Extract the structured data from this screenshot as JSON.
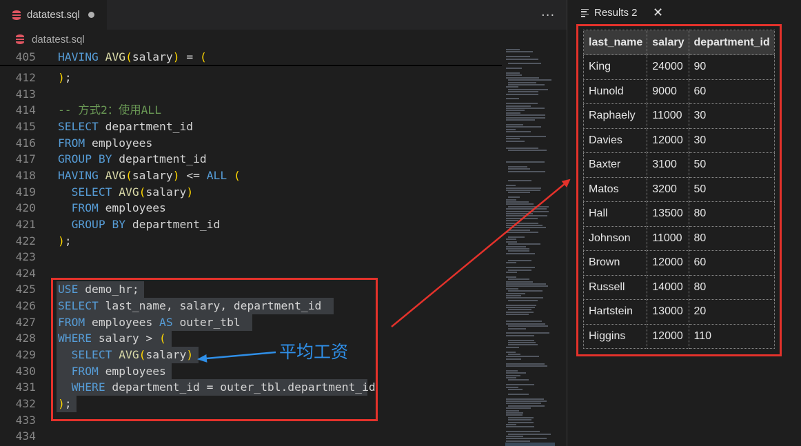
{
  "editor_tab": {
    "title": "datatest.sql",
    "more_icon": "ellipsis-icon",
    "file_icon": "database-icon"
  },
  "breadcrumb": {
    "file": "datatest.sql"
  },
  "code": {
    "sticky": {
      "num": "405",
      "text": "HAVING AVG(salary) = ("
    },
    "lines": [
      {
        "num": "412",
        "text": ");"
      },
      {
        "num": "413",
        "text": ""
      },
      {
        "num": "414",
        "text": "-- 方式2：使用ALL"
      },
      {
        "num": "415",
        "text": "SELECT department_id"
      },
      {
        "num": "416",
        "text": "FROM employees"
      },
      {
        "num": "417",
        "text": "GROUP BY department_id"
      },
      {
        "num": "418",
        "text": "HAVING AVG(salary) <= ALL ("
      },
      {
        "num": "419",
        "text": "  SELECT AVG(salary)"
      },
      {
        "num": "420",
        "text": "  FROM employees"
      },
      {
        "num": "421",
        "text": "  GROUP BY department_id"
      },
      {
        "num": "422",
        "text": ");"
      },
      {
        "num": "423",
        "text": ""
      },
      {
        "num": "424",
        "text": ""
      },
      {
        "num": "425",
        "text": "USE demo_hr;"
      },
      {
        "num": "426",
        "text": "SELECT last_name, salary, department_id"
      },
      {
        "num": "427",
        "text": "FROM employees AS outer_tbl"
      },
      {
        "num": "428",
        "text": "WHERE salary > ("
      },
      {
        "num": "429",
        "text": "  SELECT AVG(salary)"
      },
      {
        "num": "430",
        "text": "  FROM employees"
      },
      {
        "num": "431",
        "text": "  WHERE department_id = outer_tbl.department_id"
      },
      {
        "num": "432",
        "text": ");"
      },
      {
        "num": "433",
        "text": ""
      },
      {
        "num": "434",
        "text": ""
      }
    ]
  },
  "annotation": {
    "label": "平均工资"
  },
  "results": {
    "tab_title": "Results 2",
    "tab_icon": "list-icon",
    "close_icon": "close-icon",
    "columns": [
      "last_name",
      "salary",
      "department_id"
    ],
    "rows": [
      [
        "King",
        "24000",
        "90"
      ],
      [
        "Hunold",
        "9000",
        "60"
      ],
      [
        "Raphaely",
        "11000",
        "30"
      ],
      [
        "Davies",
        "12000",
        "30"
      ],
      [
        "Baxter",
        "3100",
        "50"
      ],
      [
        "Matos",
        "3200",
        "50"
      ],
      [
        "Hall",
        "13500",
        "80"
      ],
      [
        "Johnson",
        "11000",
        "80"
      ],
      [
        "Brown",
        "12000",
        "60"
      ],
      [
        "Russell",
        "14000",
        "80"
      ],
      [
        "Hartstein",
        "13000",
        "20"
      ],
      [
        "Higgins",
        "12000",
        "110"
      ]
    ]
  },
  "colors": {
    "annotation_red": "#e4322b",
    "annotation_blue": "#2f8fe8",
    "keyword": "#569cd6"
  }
}
